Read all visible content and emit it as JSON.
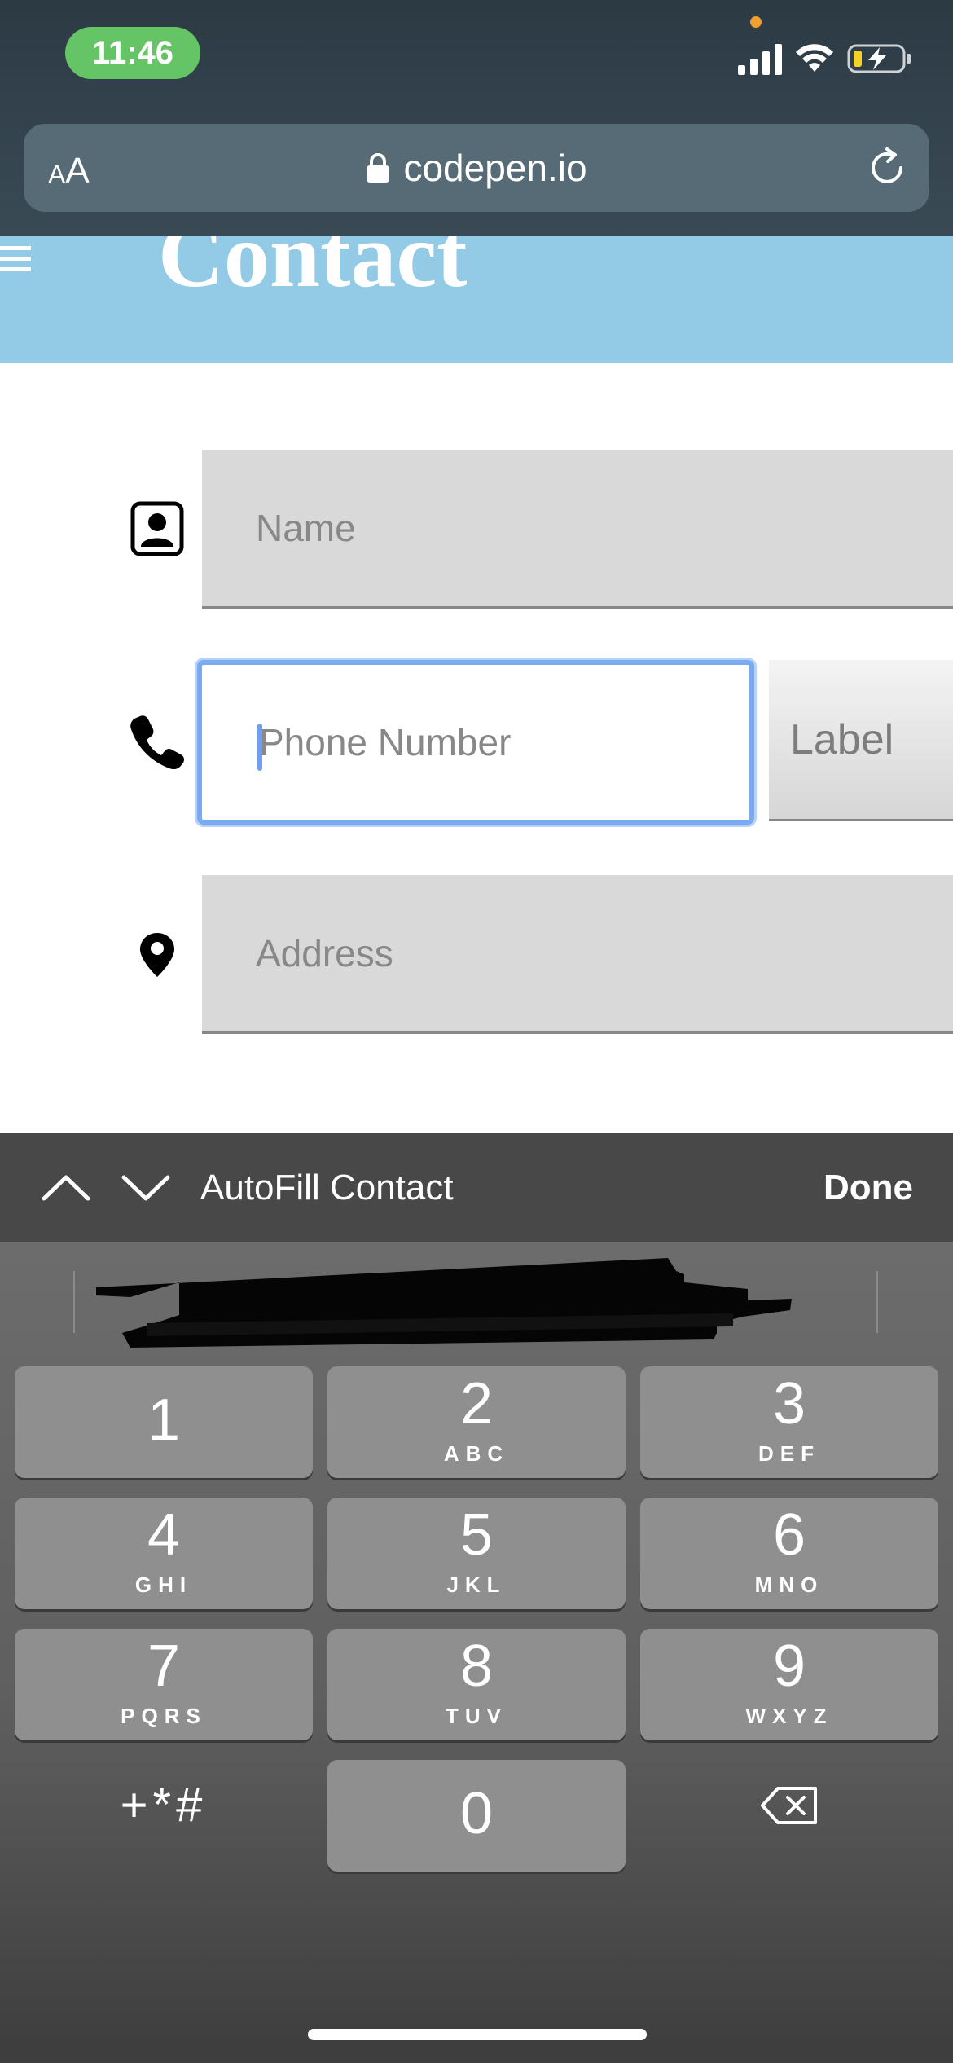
{
  "status_bar": {
    "time": "11:46",
    "icons": [
      "signal-icon",
      "wifi-icon",
      "battery-charging-icon"
    ]
  },
  "browser": {
    "text_size_small": "A",
    "text_size_large": "A",
    "url": "codepen.io",
    "icons": [
      "lock-icon",
      "reload-icon"
    ]
  },
  "page": {
    "title": "Contact",
    "header_color": "#93cae6",
    "fields": {
      "name_placeholder": "Name",
      "phone_placeholder": "Phone Number",
      "label_placeholder": "Label",
      "address_placeholder": "Address"
    },
    "icons": [
      "hamburger-menu-icon",
      "contact-card-icon",
      "phone-icon",
      "location-pin-icon"
    ]
  },
  "accessory_bar": {
    "autofill_label": "AutoFill Contact",
    "done_label": "Done"
  },
  "keypad": {
    "keys": [
      {
        "num": "1",
        "letters": ""
      },
      {
        "num": "2",
        "letters": "ABC"
      },
      {
        "num": "3",
        "letters": "DEF"
      },
      {
        "num": "4",
        "letters": "GHI"
      },
      {
        "num": "5",
        "letters": "JKL"
      },
      {
        "num": "6",
        "letters": "MNO"
      },
      {
        "num": "7",
        "letters": "PQRS"
      },
      {
        "num": "8",
        "letters": "TUV"
      },
      {
        "num": "9",
        "letters": "WXYZ"
      },
      {
        "num": "0",
        "letters": ""
      }
    ],
    "symbols_label": "+*#"
  },
  "colors": {
    "focus_ring": "#7aaaf0",
    "time_pill": "#65c466"
  }
}
